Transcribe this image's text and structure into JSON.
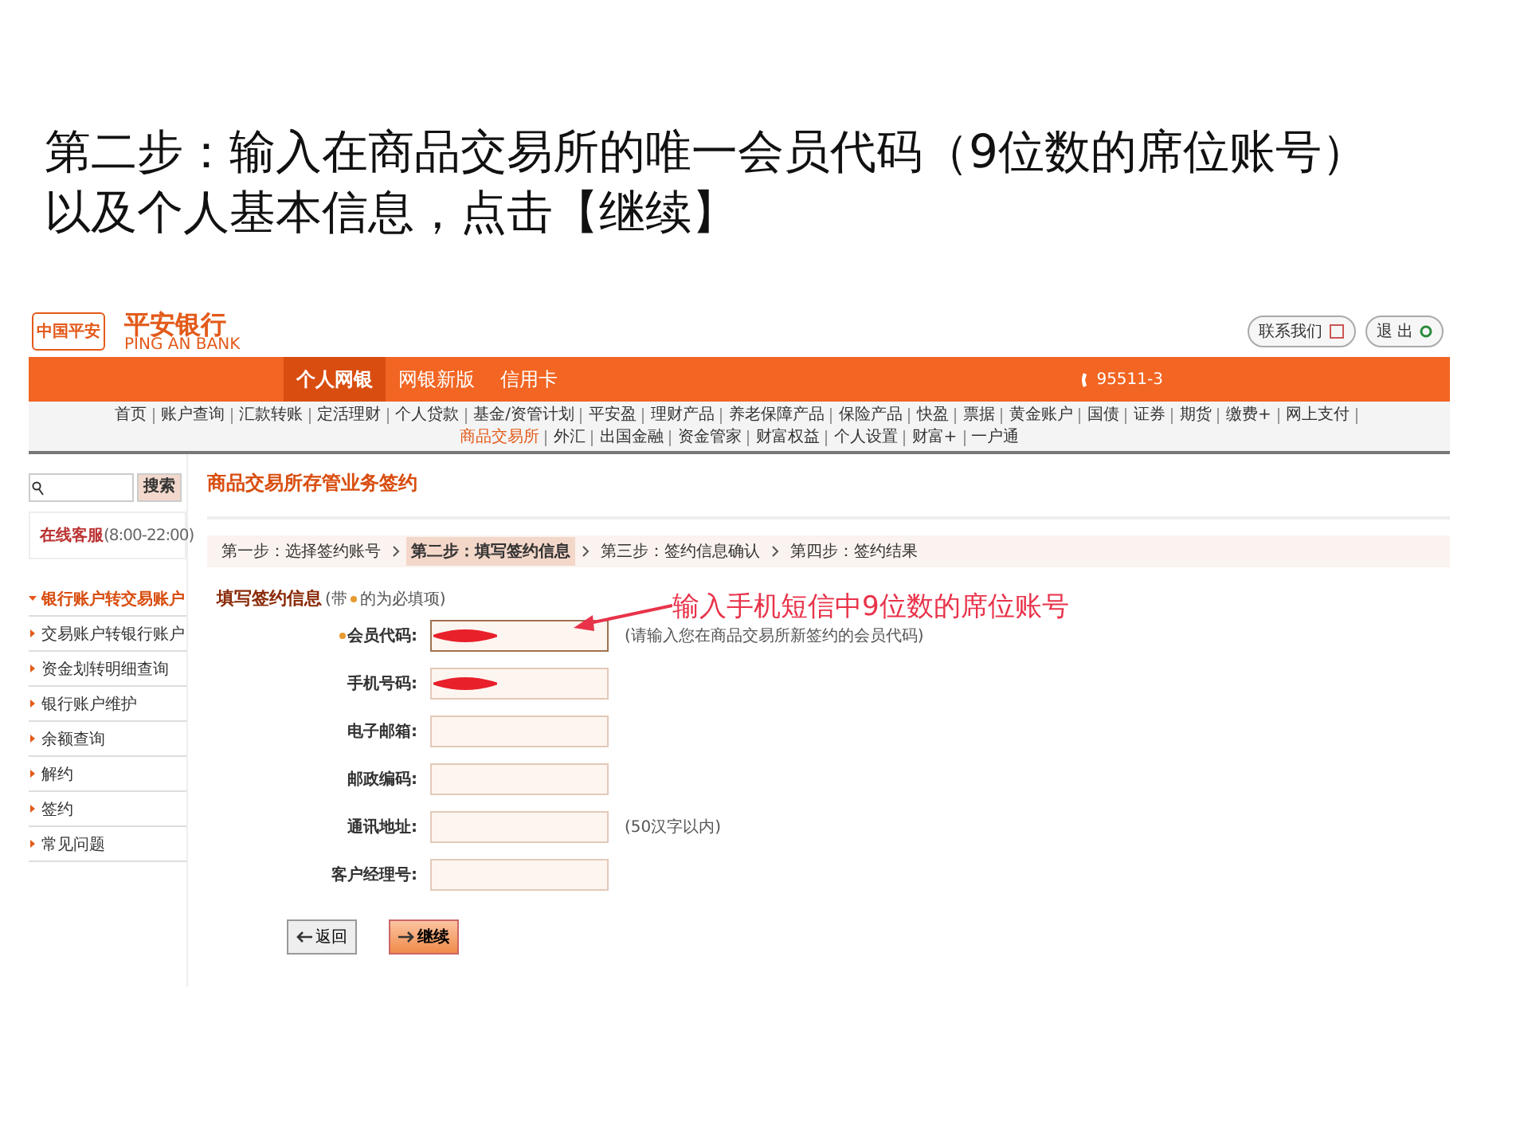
{
  "slide_title": [
    "第二步：输入在商品交易所的唯一会员代码（9位数的席位账号）",
    "以及个人基本信息，点击【继续】"
  ],
  "bank": {
    "logo_badge": "中国平安",
    "logo_name": "平安银行",
    "logo_en": "PING AN BANK",
    "contact_button": "联系我们",
    "logout_button": "退 出"
  },
  "main_tabs": [
    {
      "label": "个人网银",
      "selected": true
    },
    {
      "label": "网银新版",
      "selected": false
    },
    {
      "label": "信用卡",
      "selected": false
    }
  ],
  "hotline": "95511-3",
  "nav": [
    {
      "label": "首页",
      "selected": false
    },
    {
      "label": "账户查询",
      "selected": false
    },
    {
      "label": "汇款转账",
      "selected": false
    },
    {
      "label": "定活理财",
      "selected": false
    },
    {
      "label": "个人贷款",
      "selected": false
    },
    {
      "label": "基金/资管计划",
      "selected": false
    },
    {
      "label": "平安盈",
      "selected": false
    },
    {
      "label": "理财产品",
      "selected": false
    },
    {
      "label": "养老保障产品",
      "selected": false
    },
    {
      "label": "保险产品",
      "selected": false
    },
    {
      "label": "快盈",
      "selected": false
    },
    {
      "label": "票据",
      "selected": false
    },
    {
      "label": "黄金账户",
      "selected": false
    },
    {
      "label": "国债",
      "selected": false
    },
    {
      "label": "证券",
      "selected": false
    },
    {
      "label": "期货",
      "selected": false
    },
    {
      "label": "缴费+",
      "selected": false
    },
    {
      "label": "网上支付",
      "selected": false
    },
    {
      "label": "商品交易所",
      "selected": true
    },
    {
      "label": "外汇",
      "selected": false
    },
    {
      "label": "出国金融",
      "selected": false
    },
    {
      "label": "资金管家",
      "selected": false
    },
    {
      "label": "财富权益",
      "selected": false
    },
    {
      "label": "个人设置",
      "selected": false
    },
    {
      "label": "财富+",
      "selected": false
    },
    {
      "label": "一户通",
      "selected": false
    }
  ],
  "search_button": "搜索",
  "service": {
    "label": "在线客服",
    "hours": "(8:00-22:00)"
  },
  "side_menu": [
    {
      "label": "银行账户转交易账户",
      "selected": true
    },
    {
      "label": "交易账户转银行账户",
      "selected": false
    },
    {
      "label": "资金划转明细查询",
      "selected": false
    },
    {
      "label": "银行账户维护",
      "selected": false
    },
    {
      "label": "余额查询",
      "selected": false
    },
    {
      "label": "解约",
      "selected": false
    },
    {
      "label": "签约",
      "selected": false
    },
    {
      "label": "常见问题",
      "selected": false
    }
  ],
  "page_title": "商品交易所存管业务签约",
  "steps": [
    {
      "label": "第一步：选择签约账号",
      "selected": false
    },
    {
      "label": "第二步：填写签约信息",
      "selected": true
    },
    {
      "label": "第三步：签约信息确认",
      "selected": false
    },
    {
      "label": "第四步：签约结果",
      "selected": false
    }
  ],
  "form_title": "填写签约信息",
  "form_note_before": "(带",
  "form_note_after": "的为必填项)",
  "fields": [
    {
      "label": "会员代码:",
      "required": true,
      "redacted": true,
      "hint": "(请输入您在商品交易所新签约的会员代码)"
    },
    {
      "label": "手机号码:",
      "required": false,
      "redacted": true
    },
    {
      "label": "电子邮箱:",
      "required": false,
      "redacted": false
    },
    {
      "label": "邮政编码:",
      "required": false,
      "redacted": false
    },
    {
      "label": "通讯地址:",
      "required": false,
      "redacted": false,
      "hint": "(50汉字以内)"
    },
    {
      "label": "客户经理号:",
      "required": false,
      "redacted": false
    }
  ],
  "back_button": "返回",
  "continue_button": "继续",
  "annotation": "输入手机短信中9位数的席位账号"
}
